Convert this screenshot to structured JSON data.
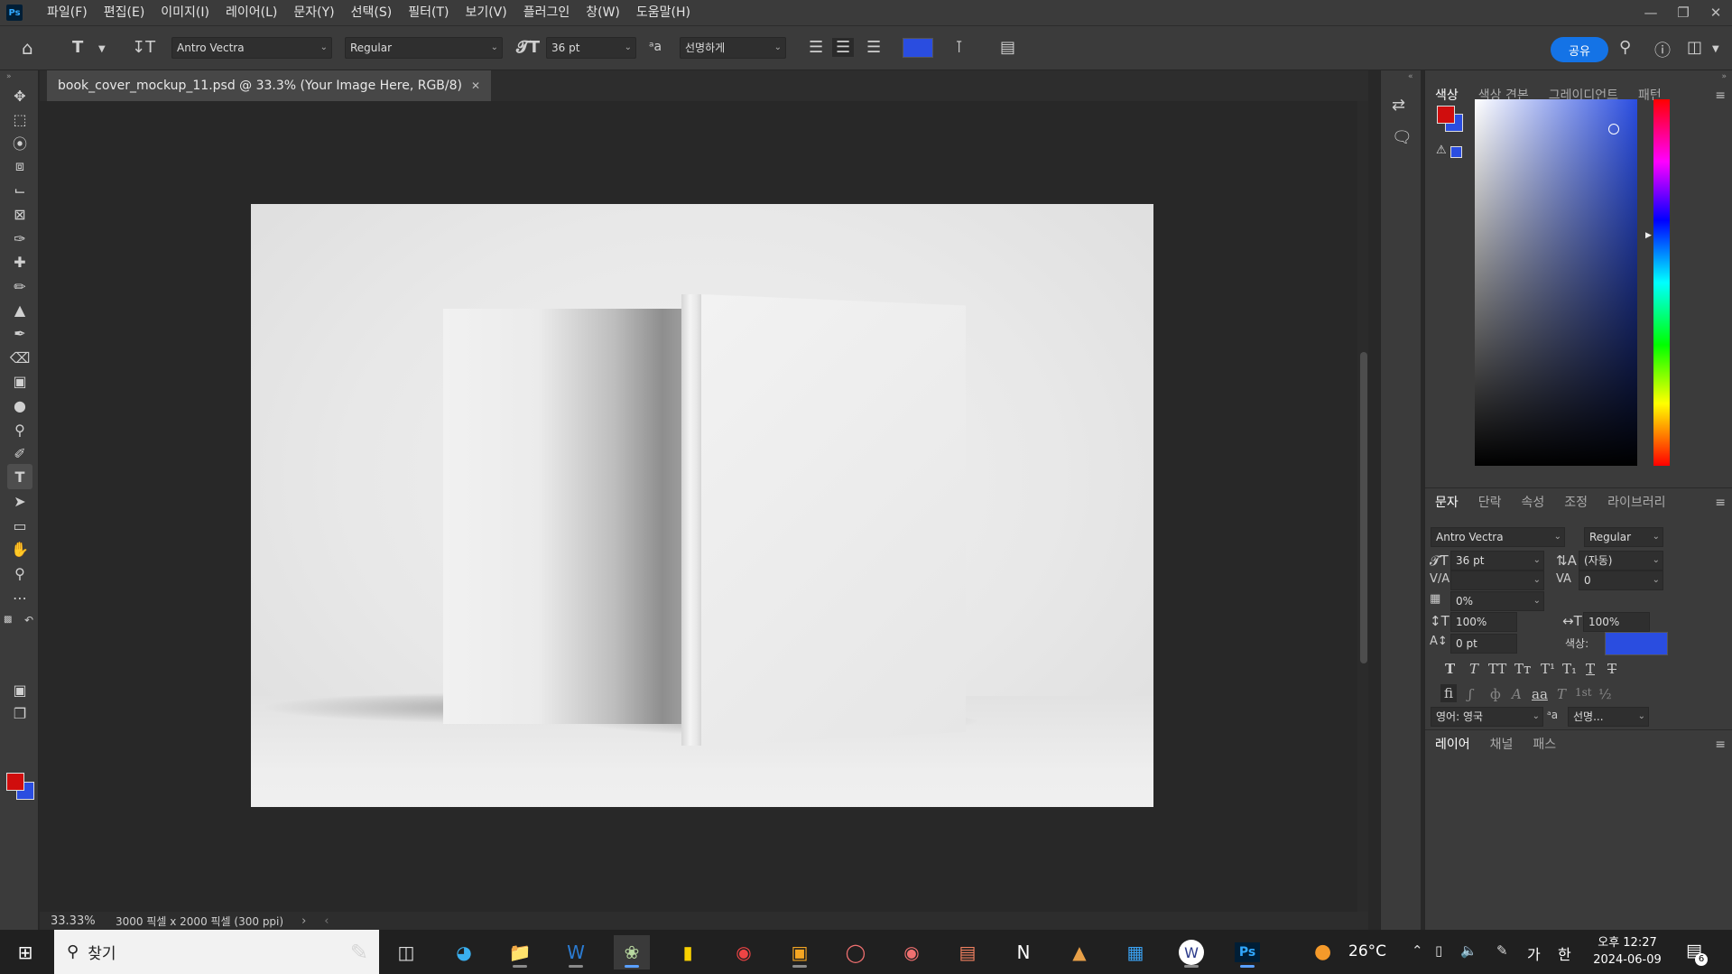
{
  "app": {
    "logo": "Ps"
  },
  "menu": [
    "파일(F)",
    "편집(E)",
    "이미지(I)",
    "레이어(L)",
    "문자(Y)",
    "선택(S)",
    "필터(T)",
    "보기(V)",
    "플러그인",
    "창(W)",
    "도움말(H)"
  ],
  "options": {
    "font_family": "Antro Vectra",
    "font_style": "Regular",
    "font_size": "36 pt",
    "antialias": "선명하게",
    "text_color": "#2a4de0",
    "share_label": "공유"
  },
  "document": {
    "tab_title": "book_cover_mockup_11.psd @ 33.3% (Your Image Here, RGB/8)",
    "zoom": "33.33%",
    "dimensions": "3000 픽셀 x 2000 픽셀 (300 ppi)"
  },
  "color_panel": {
    "tabs": [
      "색상",
      "색상 견본",
      "그레이디언트",
      "패턴"
    ],
    "active_tab": "색상",
    "foreground": "#d00d0d",
    "background": "#2a4de0"
  },
  "character_panel": {
    "tabs": [
      "문자",
      "단락",
      "속성",
      "조정",
      "라이브러리"
    ],
    "active_tab": "문자",
    "font_family": "Antro Vectra",
    "font_style": "Regular",
    "font_size": "36 pt",
    "leading": "(자동)",
    "kerning": "",
    "tracking": "0",
    "tsume": "0%",
    "vertical_scale": "100%",
    "horizontal_scale": "100%",
    "baseline_shift": "0 pt",
    "color_label": "색상:",
    "color": "#2a4de0",
    "language": "영어: 영국",
    "antialias": "선명..."
  },
  "layers_panel": {
    "tabs": [
      "레이어",
      "채널",
      "패스"
    ],
    "active_tab": "레이어"
  },
  "taskbar": {
    "search_label": "찾기",
    "temperature": "26°C",
    "ime_mode": "가",
    "ime_lang": "한",
    "time": "오후 12:27",
    "date": "2024-06-09",
    "notification_count": "6"
  }
}
